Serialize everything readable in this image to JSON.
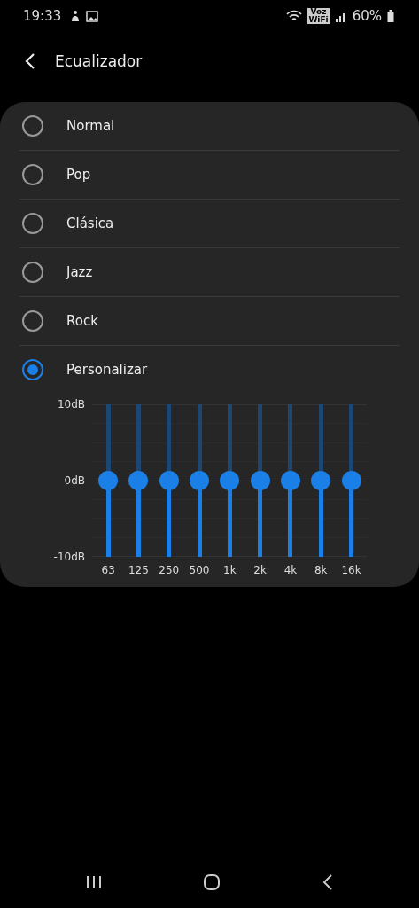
{
  "status_bar": {
    "time": "19:33",
    "wifi_calling_label": "Voz WiFi",
    "battery": "60%"
  },
  "header": {
    "title": "Ecualizador"
  },
  "presets": [
    {
      "label": "Normal",
      "selected": false
    },
    {
      "label": "Pop",
      "selected": false
    },
    {
      "label": "Clásica",
      "selected": false
    },
    {
      "label": "Jazz",
      "selected": false
    },
    {
      "label": "Rock",
      "selected": false
    },
    {
      "label": "Personalizar",
      "selected": true
    }
  ],
  "equalizer": {
    "scale": [
      "10dB",
      "0dB",
      "-10dB"
    ],
    "bands": [
      {
        "label": "63",
        "level": 0.5
      },
      {
        "label": "125",
        "level": 0.5
      },
      {
        "label": "250",
        "level": 0.5
      },
      {
        "label": "500",
        "level": 0.5
      },
      {
        "label": "1k",
        "level": 0.5
      },
      {
        "label": "2k",
        "level": 0.5
      },
      {
        "label": "4k",
        "level": 0.5
      },
      {
        "label": "8k",
        "level": 0.5
      },
      {
        "label": "16k",
        "level": 0.5
      }
    ]
  }
}
